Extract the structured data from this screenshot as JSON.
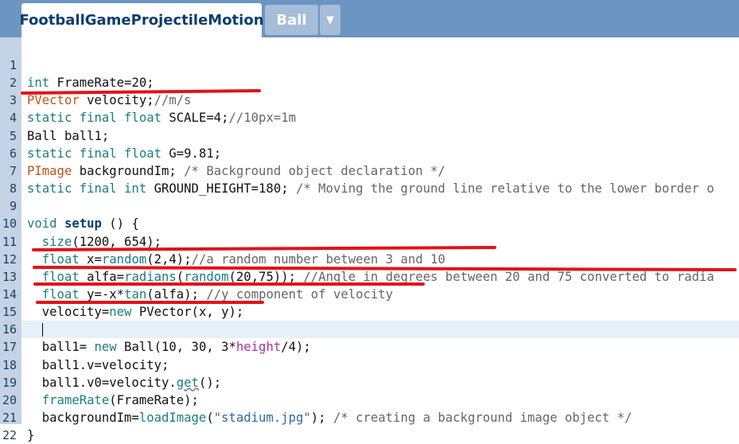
{
  "tabs": {
    "main_tab": "FootballGameProjectileMotion",
    "second_tab": "Ball",
    "dropdown_arrow": "▼"
  },
  "colors": {
    "tabbar_bg": "#6c95c2",
    "gutter_bg": "#c4d3e5",
    "annotation_red": "#e0131a",
    "active_line_bg": "#e6f0fb"
  },
  "editor": {
    "active_line": 16,
    "lines": [
      {
        "n": "1",
        "parts": []
      },
      {
        "n": "2",
        "parts": [
          {
            "t": "int",
            "c": "kw"
          },
          {
            "t": " FrameRate=20;",
            "c": ""
          }
        ]
      },
      {
        "n": "3",
        "parts": [
          {
            "t": "PVector",
            "c": "cls"
          },
          {
            "t": " velocity;",
            "c": ""
          },
          {
            "t": "//m/s",
            "c": "cm"
          }
        ]
      },
      {
        "n": "4",
        "parts": [
          {
            "t": "static final float",
            "c": "kw"
          },
          {
            "t": " SCALE=4;",
            "c": ""
          },
          {
            "t": "//10px=1m",
            "c": "cm"
          }
        ]
      },
      {
        "n": "5",
        "parts": [
          {
            "t": "Ball ball1;",
            "c": ""
          }
        ]
      },
      {
        "n": "6",
        "parts": [
          {
            "t": "static final float",
            "c": "kw"
          },
          {
            "t": " G=9.81;",
            "c": ""
          }
        ]
      },
      {
        "n": "7",
        "parts": [
          {
            "t": "PImage",
            "c": "cls"
          },
          {
            "t": " backgroundIm; ",
            "c": ""
          },
          {
            "t": "/* Background object declaration */",
            "c": "cm"
          }
        ]
      },
      {
        "n": "8",
        "parts": [
          {
            "t": "static final int",
            "c": "kw"
          },
          {
            "t": " GROUND_HEIGHT=180; ",
            "c": ""
          },
          {
            "t": "/* Moving the ground line relative to the lower border o",
            "c": "cm"
          }
        ]
      },
      {
        "n": "9",
        "parts": []
      },
      {
        "n": "10",
        "parts": [
          {
            "t": "void",
            "c": "kw"
          },
          {
            "t": " ",
            "c": ""
          },
          {
            "t": "setup",
            "c": "kwb"
          },
          {
            "t": " () {",
            "c": ""
          }
        ]
      },
      {
        "n": "11",
        "parts": [
          {
            "t": "  ",
            "c": ""
          },
          {
            "t": "size",
            "c": "fn"
          },
          {
            "t": "(1200, 654);",
            "c": ""
          }
        ]
      },
      {
        "n": "12",
        "parts": [
          {
            "t": "  ",
            "c": ""
          },
          {
            "t": "float",
            "c": "kw"
          },
          {
            "t": " x=",
            "c": ""
          },
          {
            "t": "random",
            "c": "fn"
          },
          {
            "t": "(2,4);",
            "c": ""
          },
          {
            "t": "//a random number between 3 and 10",
            "c": "cm"
          }
        ]
      },
      {
        "n": "13",
        "parts": [
          {
            "t": "  ",
            "c": ""
          },
          {
            "t": "float",
            "c": "kw"
          },
          {
            "t": " alfa=",
            "c": ""
          },
          {
            "t": "radians",
            "c": "fn"
          },
          {
            "t": "(",
            "c": ""
          },
          {
            "t": "random",
            "c": "fn"
          },
          {
            "t": "(20,75)); ",
            "c": ""
          },
          {
            "t": "//Angle in degrees between 20 and 75 converted to radia",
            "c": "cm"
          }
        ]
      },
      {
        "n": "14",
        "parts": [
          {
            "t": "  ",
            "c": ""
          },
          {
            "t": "float",
            "c": "kw"
          },
          {
            "t": " y=-x*",
            "c": ""
          },
          {
            "t": "tan",
            "c": "fn"
          },
          {
            "t": "(alfa); ",
            "c": ""
          },
          {
            "t": "//y component of velocity",
            "c": "cm"
          }
        ]
      },
      {
        "n": "15",
        "parts": [
          {
            "t": "  velocity=",
            "c": ""
          },
          {
            "t": "new",
            "c": "kw"
          },
          {
            "t": " PVector(x, y);",
            "c": ""
          }
        ]
      },
      {
        "n": "16",
        "parts": [
          {
            "t": "  ",
            "c": ""
          },
          {
            "t": "",
            "c": "cursor"
          }
        ]
      },
      {
        "n": "17",
        "parts": [
          {
            "t": "  ball1= ",
            "c": ""
          },
          {
            "t": "new",
            "c": "kw"
          },
          {
            "t": " Ball(10, 30, 3*",
            "c": ""
          },
          {
            "t": "height",
            "c": "mag"
          },
          {
            "t": "/4);",
            "c": ""
          }
        ]
      },
      {
        "n": "18",
        "parts": [
          {
            "t": "  ball1.v=velocity;",
            "c": ""
          }
        ]
      },
      {
        "n": "19",
        "parts": [
          {
            "t": "  ball1.v0=velocity.",
            "c": ""
          },
          {
            "t": "get",
            "c": "fn squiggle"
          },
          {
            "t": "();",
            "c": ""
          }
        ]
      },
      {
        "n": "20",
        "parts": [
          {
            "t": "  ",
            "c": ""
          },
          {
            "t": "frameRate",
            "c": "fn"
          },
          {
            "t": "(FrameRate);",
            "c": ""
          }
        ]
      },
      {
        "n": "21",
        "parts": [
          {
            "t": "  backgroundIm=",
            "c": ""
          },
          {
            "t": "loadImage",
            "c": "fn"
          },
          {
            "t": "(",
            "c": ""
          },
          {
            "t": "\"stadium.jpg\"",
            "c": "str"
          },
          {
            "t": "); ",
            "c": ""
          },
          {
            "t": "/* creating a background image object */",
            "c": "cm"
          }
        ]
      },
      {
        "n": "22",
        "parts": [
          {
            "t": "}",
            "c": ""
          }
        ]
      }
    ]
  }
}
